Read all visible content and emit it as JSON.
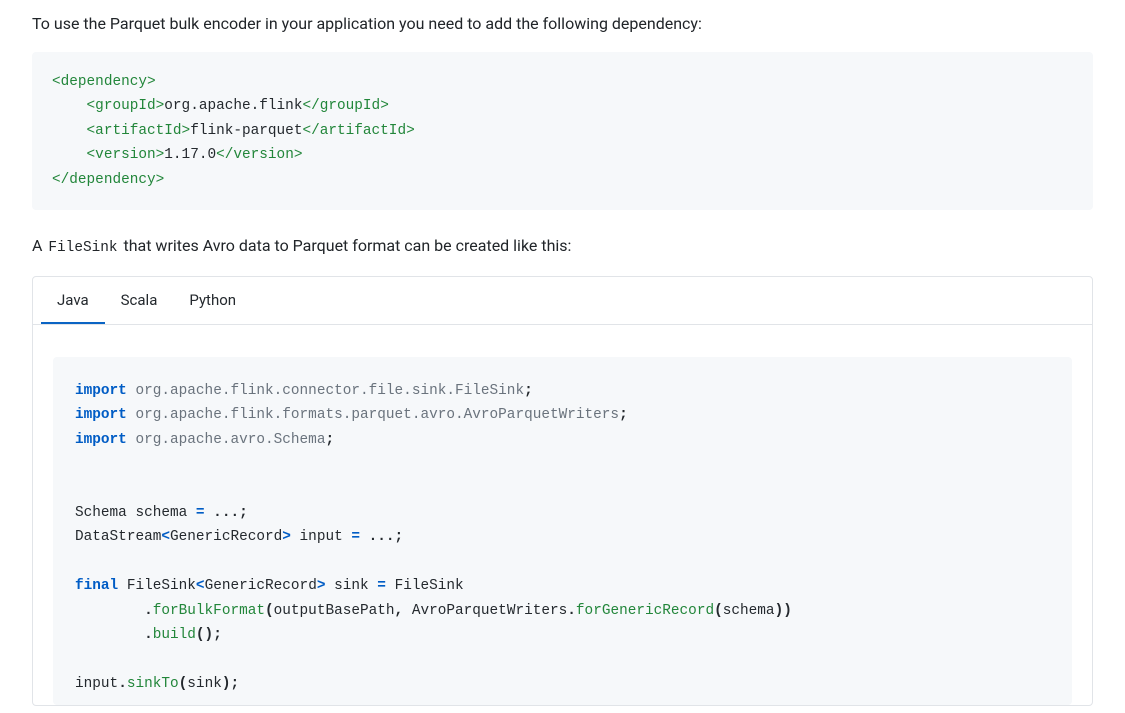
{
  "intro_text": "To use the Parquet bulk encoder in your application you need to add the following dependency:",
  "dependency_xml": {
    "root_open": "<dependency>",
    "groupId_open": "<groupId>",
    "groupId_value": "org.apache.flink",
    "groupId_close": "</groupId>",
    "artifactId_open": "<artifactId>",
    "artifactId_value": "flink-parquet",
    "artifactId_close": "</artifactId>",
    "version_open": "<version>",
    "version_value": "1.17.0",
    "version_close": "</version>",
    "root_close": "</dependency>"
  },
  "filesink_sentence": {
    "pre": "A ",
    "code": "FileSink",
    "post": " that writes Avro data to Parquet format can be created like this:"
  },
  "tabs": [
    "Java",
    "Scala",
    "Python"
  ],
  "active_tab": "Java",
  "java_code": {
    "import_kw": "import",
    "final_kw": "final",
    "import1_pkg": "org.apache.flink.connector.file.sink.FileSink",
    "import2_pkg": "org.apache.flink.formats.parquet.avro.AvroParquetWriters",
    "import3_pkg": "org.apache.avro.Schema",
    "line_schema": "Schema schema ",
    "eq": "=",
    "dots": " ...;",
    "line_ds_a": "DataStream",
    "lt": "<",
    "gt": ">",
    "gr": "GenericRecord",
    "input_decl": " input ",
    "sink_decl_a": " FileSink",
    "sink_decl_b": " sink ",
    "sink_decl_c": " FileSink",
    "forBulkFormat": "forBulkFormat",
    "args1": "outputBasePath",
    "comma": ",",
    "apw": " AvroParquetWriters",
    "dot": ".",
    "forGenericRecord": "forGenericRecord",
    "schema_arg": "schema",
    "build": "build",
    "empty_parens": "();",
    "input_var": "input",
    "sinkTo": "sinkTo",
    "sink_arg": "sink",
    "close_stmt": ");",
    "open_paren": "(",
    "close_paren": ")",
    "close_paren2": "))",
    "semi": ";"
  }
}
